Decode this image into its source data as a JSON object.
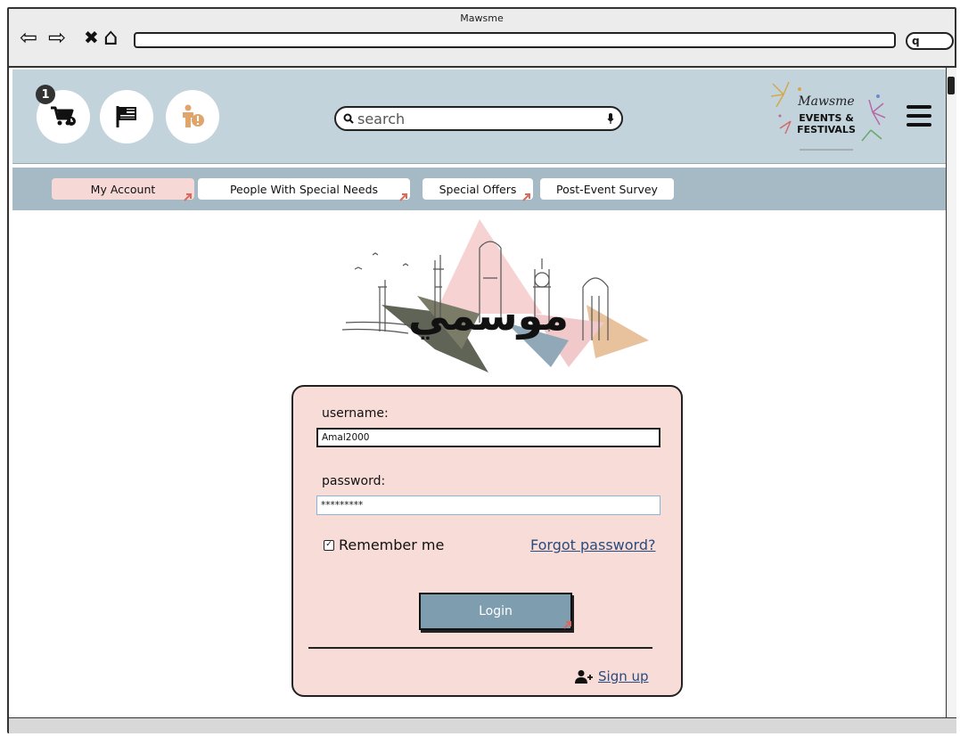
{
  "browser": {
    "title": "Mawsme",
    "nav": {
      "back": "⇦",
      "forward": "⇨",
      "stop": "✖",
      "home": "⌂"
    }
  },
  "header": {
    "cart_count": "1",
    "search_placeholder": "search",
    "logo": {
      "line1": "Mawsme",
      "line2": "EVENTS &",
      "line3": "FESTIVALS"
    },
    "icons": [
      "cart-icon",
      "flag-icon",
      "accessibility-icon",
      "mic-icon",
      "search-icon",
      "menu-icon"
    ]
  },
  "nav_tabs": [
    {
      "label": "My Account",
      "active": true
    },
    {
      "label": "People With Special Needs",
      "active": false
    },
    {
      "label": "Special Offers",
      "active": false
    },
    {
      "label": "Post-Event Survey",
      "active": false
    }
  ],
  "hero": {
    "arabic_text": "موسمي"
  },
  "login": {
    "username_label": "username:",
    "username_value": "Amal2000",
    "password_label": "password:",
    "password_value": "*********",
    "remember_label": "Remember me",
    "remember_checked": true,
    "forgot_label": "Forgot password?",
    "login_button": "Login",
    "signup_label": "Sign up"
  },
  "colors": {
    "header_bg": "#c2d3dc",
    "nav_bg": "#a6bac6",
    "active_tab": "#f6d9d6",
    "card_bg": "#f8dcd8",
    "button_bg": "#7e9eb0",
    "link": "#2a4b7c",
    "accent_arrow": "#e0675b"
  }
}
